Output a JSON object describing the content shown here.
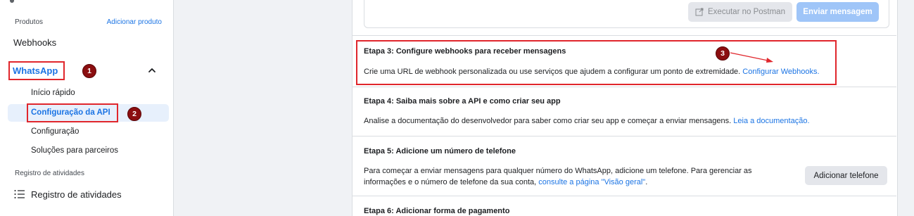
{
  "sidebar": {
    "products_label": "Produtos",
    "add_product": "Adicionar produto",
    "webhooks": "Webhooks",
    "whatsapp": "WhatsApp",
    "subitems": [
      "Início rápido",
      "Configuração da API",
      "Configuração",
      "Soluções para parceiros"
    ],
    "activity_label": "Registro de atividades",
    "activity_item": "Registro de atividades"
  },
  "markers": [
    "1",
    "2",
    "3"
  ],
  "toolbar": {
    "postman_label": "Executar no Postman",
    "send_label": "Enviar mensagem"
  },
  "steps": {
    "step3": {
      "title": "Etapa 3: Configure webhooks para receber mensagens",
      "desc": "Crie uma URL de webhook personalizada ou use serviços que ajudem a configurar um ponto de extremidade.",
      "link": "Configurar Webhooks."
    },
    "step4": {
      "title": "Etapa 4: Saiba mais sobre a API e como criar seu app",
      "desc": "Analise a documentação do desenvolvedor para saber como criar seu app e começar a enviar mensagens.",
      "link": "Leia a documentação."
    },
    "step5": {
      "title": "Etapa 5: Adicione um número de telefone",
      "desc_line1": "Para começar a enviar mensagens para qualquer número do WhatsApp, adicione um telefone. Para gerenciar as",
      "desc_line2": "informações e o número de telefone da sua conta,",
      "link": "consulte a página \"Visão geral\"",
      "desc_end": ".",
      "button": "Adicionar telefone"
    },
    "step6": {
      "title": "Etapa 6: Adicionar forma de pagamento"
    }
  },
  "colors": {
    "accent": "#1b74e4",
    "annotation_red": "#e0262c",
    "marker": "#8b0e10"
  },
  "icons": {
    "chevron": "chevron-up-icon",
    "external": "external-link-icon",
    "list": "list-icon"
  }
}
